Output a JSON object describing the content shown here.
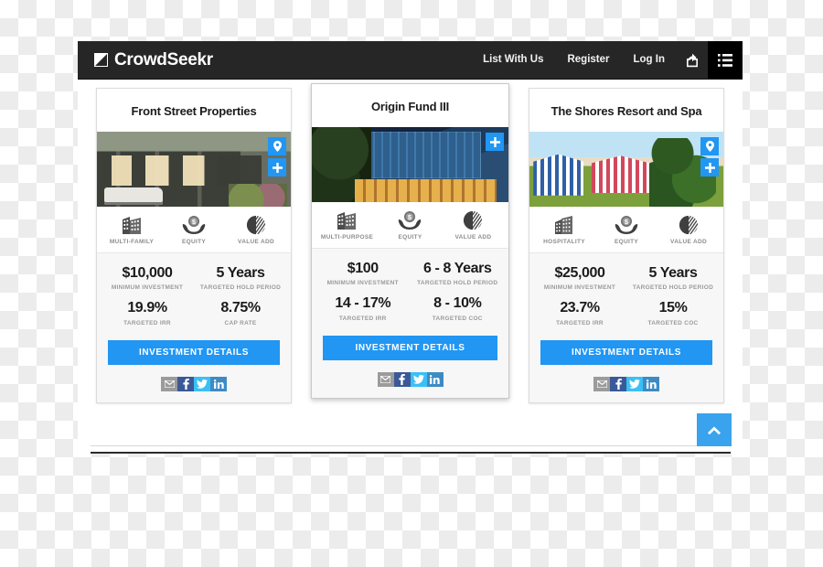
{
  "nav": {
    "brand": "CrowdSeekr",
    "brand_icon": "flag-triangle-icon",
    "links": [
      {
        "label": "List With Us"
      },
      {
        "label": "Register"
      },
      {
        "label": "Log In"
      }
    ],
    "share_icon": "share-export-icon",
    "list_icon": "list-view-icon"
  },
  "cards": [
    {
      "title": "Front Street Properties",
      "photo": "industrial-townhomes-photo",
      "badges": [
        "map-pin-icon",
        "plus-icon"
      ],
      "attributes": [
        {
          "icon": "building-icon",
          "label": "MULTI-FAMILY"
        },
        {
          "icon": "hands-dollar-icon",
          "label": "EQUITY"
        },
        {
          "icon": "pie-chart-icon",
          "label": "VALUE ADD"
        }
      ],
      "stats": [
        {
          "value": "$10,000",
          "label": "MINIMUM INVESTMENT"
        },
        {
          "value": "5 Years",
          "label": "TARGETED HOLD PERIOD"
        },
        {
          "value": "19.9%",
          "label": "TARGETED IRR"
        },
        {
          "value": "8.75%",
          "label": "CAP RATE"
        }
      ],
      "cta": "INVESTMENT DETAILS",
      "social": [
        {
          "icon": "email-icon",
          "name": "email"
        },
        {
          "icon": "facebook-icon",
          "name": "facebook"
        },
        {
          "icon": "twitter-icon",
          "name": "twitter"
        },
        {
          "icon": "linkedin-icon",
          "name": "linkedin"
        }
      ]
    },
    {
      "title": "Origin Fund III",
      "photo": "glass-office-building-photo",
      "badges": [
        "plus-icon"
      ],
      "attributes": [
        {
          "icon": "building-icon",
          "label": "MULTI-PURPOSE"
        },
        {
          "icon": "hands-dollar-icon",
          "label": "EQUITY"
        },
        {
          "icon": "pie-chart-icon",
          "label": "VALUE ADD"
        }
      ],
      "stats": [
        {
          "value": "$100",
          "label": "MINIMUM INVESTMENT"
        },
        {
          "value": "6 - 8 Years",
          "label": "TARGETED HOLD PERIOD"
        },
        {
          "value": "14 - 17%",
          "label": "TARGETED IRR"
        },
        {
          "value": "8 - 10%",
          "label": "TARGETED COC"
        }
      ],
      "cta": "INVESTMENT DETAILS",
      "social": [
        {
          "icon": "email-icon",
          "name": "email"
        },
        {
          "icon": "facebook-icon",
          "name": "facebook"
        },
        {
          "icon": "twitter-icon",
          "name": "twitter"
        },
        {
          "icon": "linkedin-icon",
          "name": "linkedin"
        }
      ]
    },
    {
      "title": "The Shores Resort and Spa",
      "photo": "beach-cabanas-resort-photo",
      "badges": [
        "map-pin-icon",
        "plus-icon"
      ],
      "attributes": [
        {
          "icon": "building-icon",
          "label": "HOSPITALITY"
        },
        {
          "icon": "hands-dollar-icon",
          "label": "EQUITY"
        },
        {
          "icon": "pie-chart-icon",
          "label": "VALUE ADD"
        }
      ],
      "stats": [
        {
          "value": "$25,000",
          "label": "MINIMUM INVESTMENT"
        },
        {
          "value": "5 Years",
          "label": "TARGETED HOLD PERIOD"
        },
        {
          "value": "23.7%",
          "label": "TARGETED IRR"
        },
        {
          "value": "15%",
          "label": "TARGETED COC"
        }
      ],
      "cta": "INVESTMENT DETAILS",
      "social": [
        {
          "icon": "email-icon",
          "name": "email"
        },
        {
          "icon": "facebook-icon",
          "name": "facebook"
        },
        {
          "icon": "twitter-icon",
          "name": "twitter"
        },
        {
          "icon": "linkedin-icon",
          "name": "linkedin"
        }
      ]
    }
  ],
  "scroll_top": {
    "icon": "chevron-up-icon"
  },
  "colors": {
    "accent": "#2196f3",
    "navbar": "#262626",
    "facebook": "#3b5998",
    "twitter": "#3bc0f5",
    "linkedin": "#3d8bc4",
    "email": "#9b9b9b",
    "scroll_top": "#3aa3ee"
  }
}
